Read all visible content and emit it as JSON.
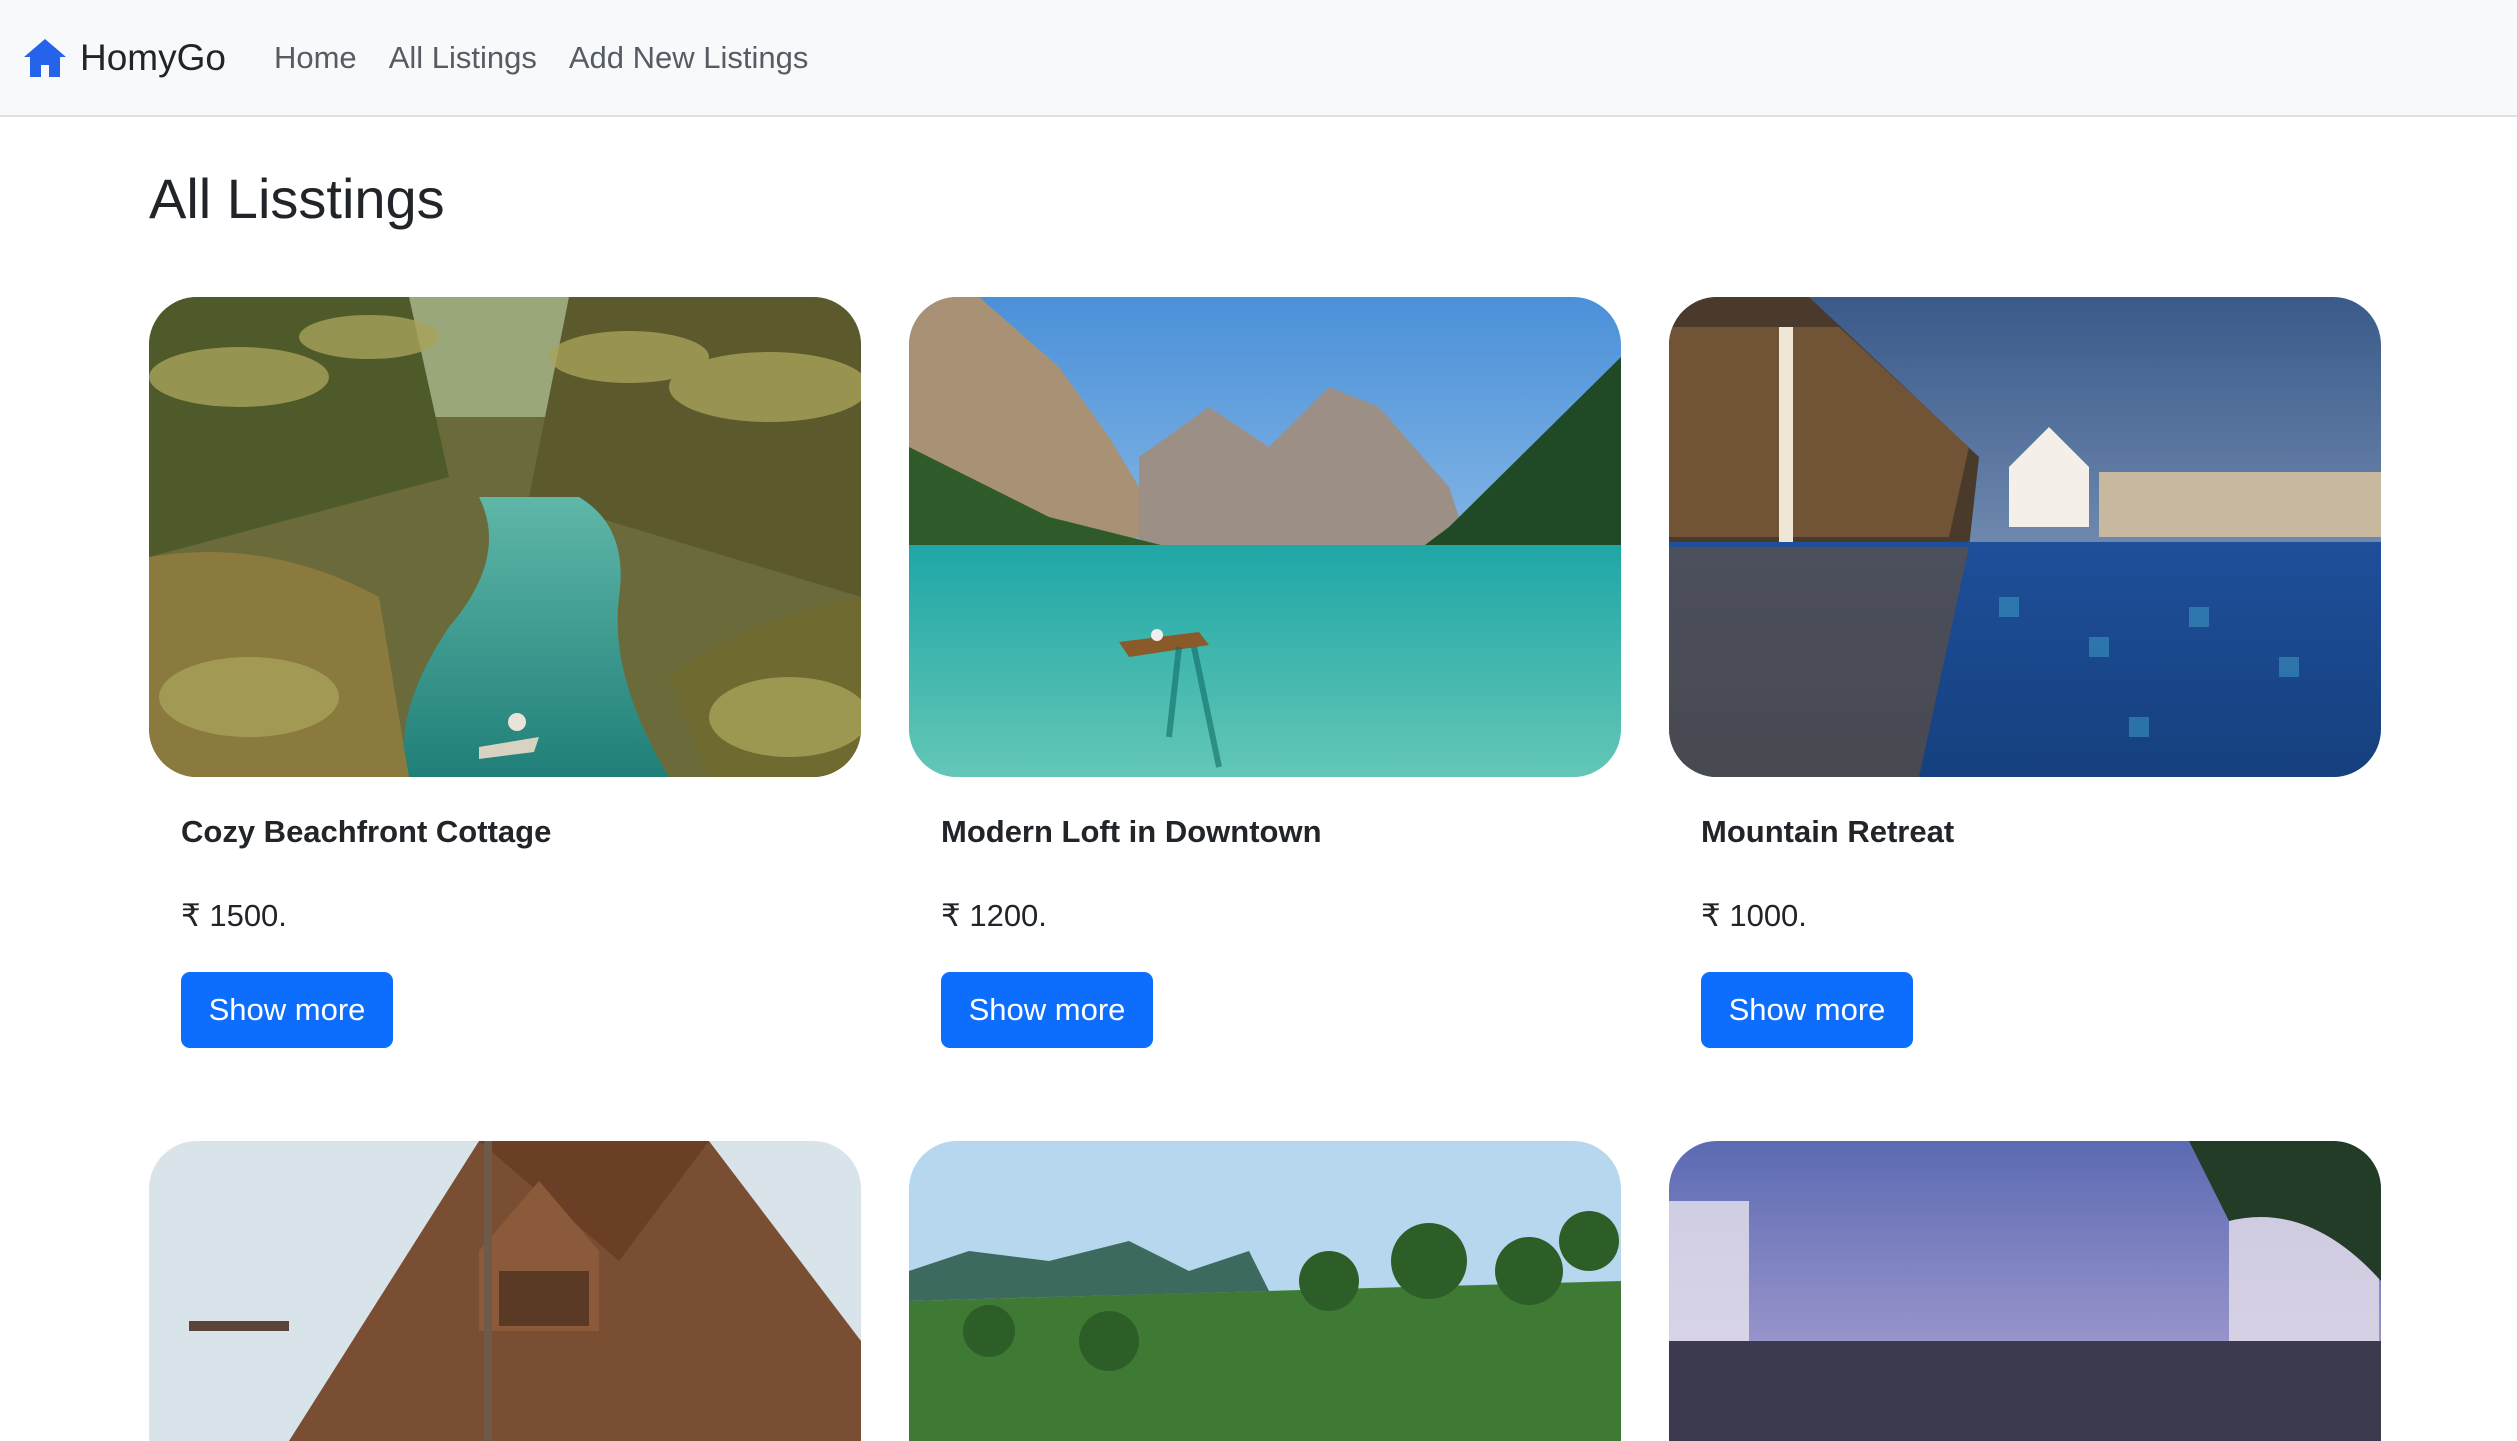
{
  "navbar": {
    "brand": "HomyGo",
    "links": [
      "Home",
      "All Listings",
      "Add New Listings"
    ],
    "brand_color": "#2563eb"
  },
  "page_title": "All Lisstings",
  "listings": [
    {
      "title": "Cozy Beachfront Cottage",
      "price": "₹ 1500.",
      "button": "Show more",
      "image": "tropical-lagoon-palms"
    },
    {
      "title": "Modern Loft in Downtown",
      "price": "₹ 1200.",
      "button": "Show more",
      "image": "mountain-lake-boat"
    },
    {
      "title": "Mountain Retreat",
      "price": "₹ 1000.",
      "button": "Show more",
      "image": "resort-pool-night"
    },
    {
      "title": "",
      "price": "",
      "button": "",
      "image": "wooden-cabin-roof"
    },
    {
      "title": "",
      "price": "",
      "button": "",
      "image": "tropical-cliffs-palms"
    },
    {
      "title": "",
      "price": "",
      "button": "",
      "image": "beach-cabanas-dusk"
    }
  ],
  "colors": {
    "primary_button": "#0d6efd",
    "navbar_bg": "#f8f9fa"
  }
}
